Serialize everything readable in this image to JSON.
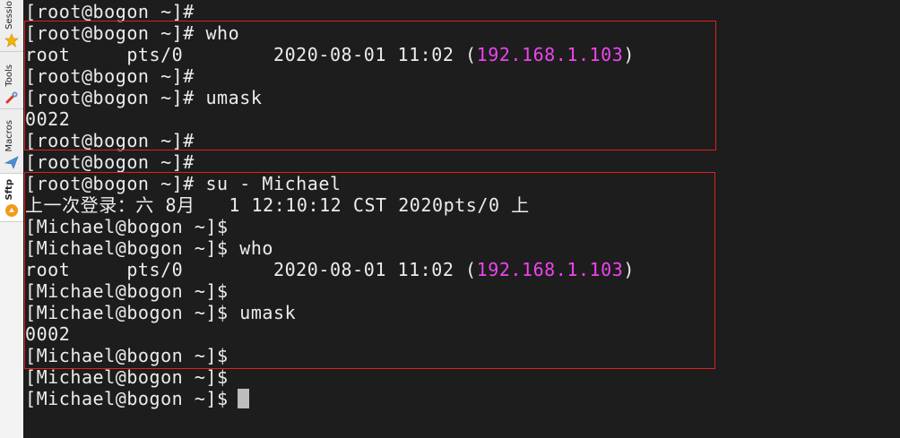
{
  "sidebar": {
    "tabs": [
      {
        "label": "Sessio",
        "icon": "star-icon"
      },
      {
        "label": "Tools",
        "icon": "tools-icon"
      },
      {
        "label": "Macros",
        "icon": "macros-icon"
      },
      {
        "label": "Sftp",
        "icon": "sftp-icon"
      }
    ]
  },
  "terminal": {
    "lines": [
      {
        "text": "[root@bogon ~]#"
      },
      {
        "text": "[root@bogon ~]# who"
      },
      {
        "pre": "root     pts/0        2020-08-01 11:02 (",
        "ip": "192.168.1.103",
        "post": ")"
      },
      {
        "text": "[root@bogon ~]#"
      },
      {
        "text": "[root@bogon ~]# umask"
      },
      {
        "text": "0022"
      },
      {
        "text": "[root@bogon ~]#"
      },
      {
        "text": "[root@bogon ~]#"
      },
      {
        "text": "[root@bogon ~]# su - Michael"
      },
      {
        "text": "上一次登录：六 8月   1 12:10:12 CST 2020pts/0 上"
      },
      {
        "text": "[Michael@bogon ~]$"
      },
      {
        "text": "[Michael@bogon ~]$ who"
      },
      {
        "pre": "root     pts/0        2020-08-01 11:02 (",
        "ip": "192.168.1.103",
        "post": ")"
      },
      {
        "text": "[Michael@bogon ~]$"
      },
      {
        "text": "[Michael@bogon ~]$ umask"
      },
      {
        "text": "0002"
      },
      {
        "text": "[Michael@bogon ~]$"
      },
      {
        "text": "[Michael@bogon ~]$"
      },
      {
        "text": "[Michael@bogon ~]$"
      }
    ]
  },
  "colors": {
    "terminal_bg": "#1d1d1d",
    "text": "#ececec",
    "ip": "#ee44ee",
    "highlight_border": "#e02020"
  }
}
